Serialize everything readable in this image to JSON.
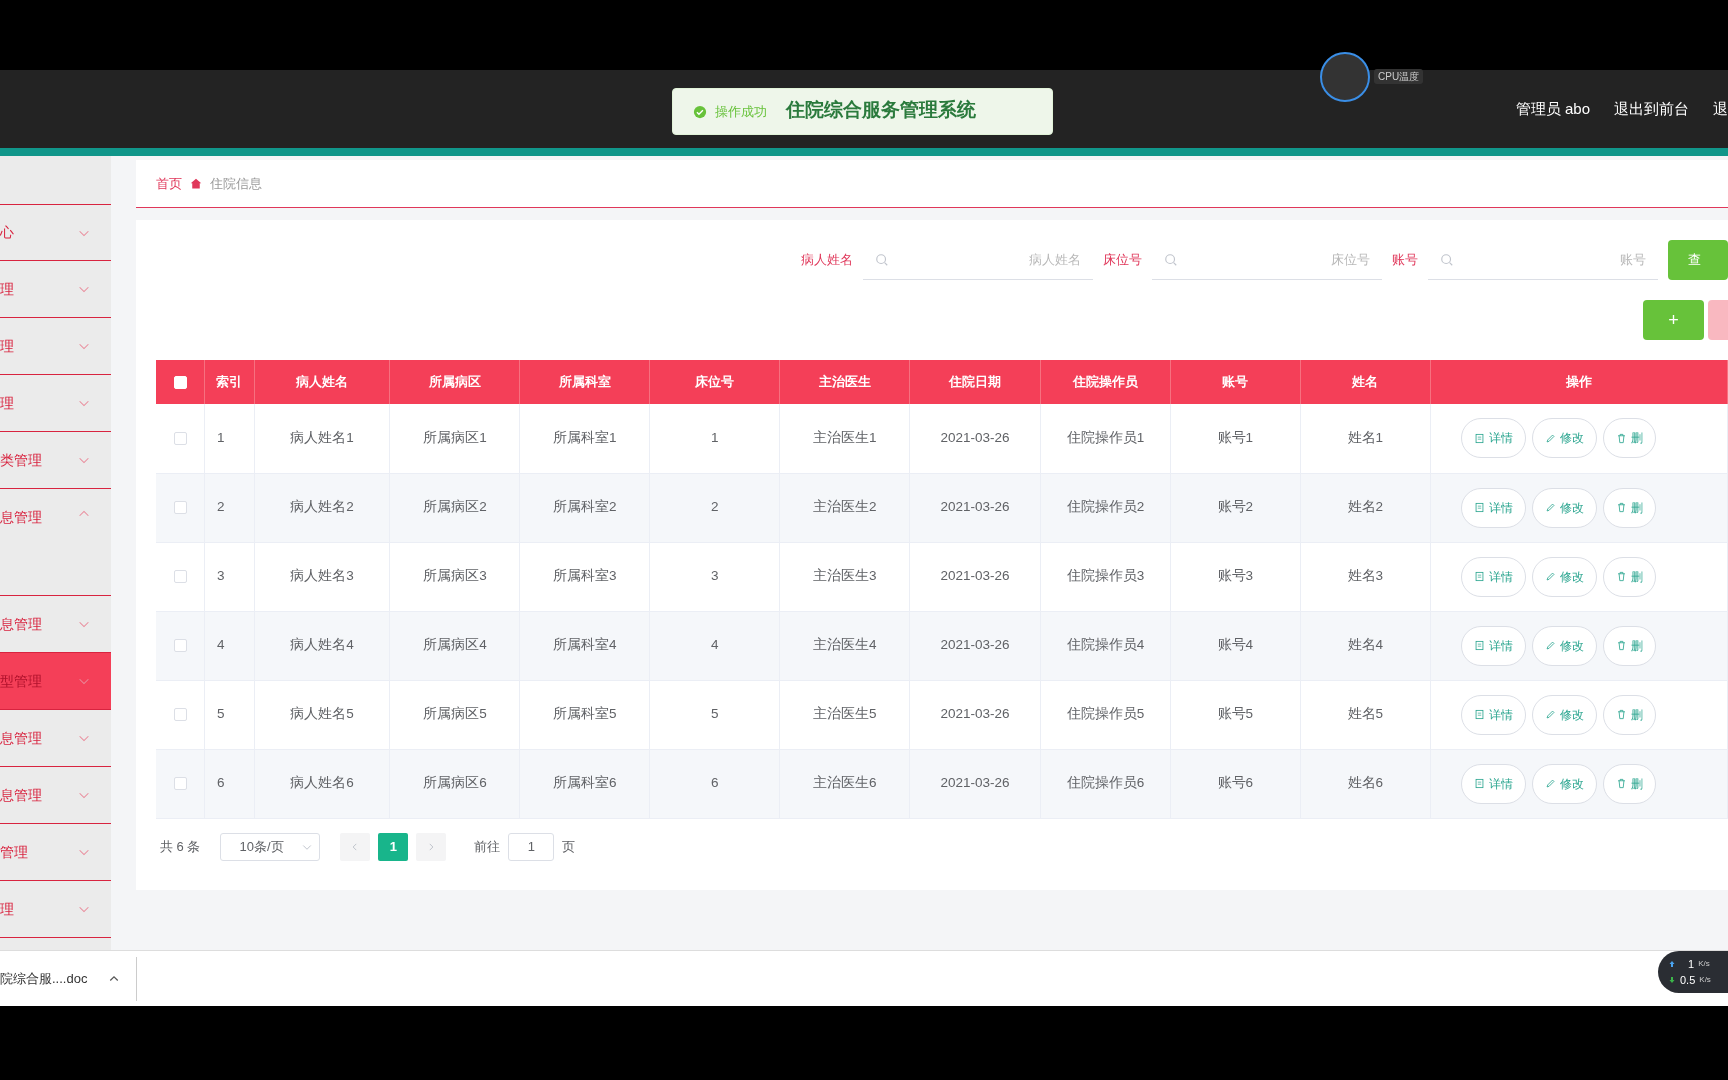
{
  "header": {
    "title": "住院综合服务管理系统",
    "user": "管理员 abo",
    "links": [
      "退出到前台",
      "退"
    ]
  },
  "toast": {
    "message": "操作成功"
  },
  "cpu_widget": {
    "label": "CPU温度"
  },
  "sidebar": {
    "items": [
      {
        "label": "心",
        "expanded": false,
        "selected": false
      },
      {
        "label": "理",
        "expanded": false,
        "selected": false
      },
      {
        "label": "理",
        "expanded": false,
        "selected": false
      },
      {
        "label": "理",
        "expanded": false,
        "selected": false
      },
      {
        "label": "类管理",
        "expanded": false,
        "selected": false
      },
      {
        "label": "息管理",
        "expanded": true,
        "selected": false
      },
      {
        "label": "息管理",
        "expanded": false,
        "selected": false
      },
      {
        "label": "型管理",
        "expanded": false,
        "selected": true
      },
      {
        "label": "息管理",
        "expanded": false,
        "selected": false
      },
      {
        "label": "息管理",
        "expanded": false,
        "selected": false
      },
      {
        "label": "管理",
        "expanded": false,
        "selected": false
      },
      {
        "label": "理",
        "expanded": false,
        "selected": false
      }
    ]
  },
  "breadcrumb": [
    "首页",
    "住院信息"
  ],
  "search": {
    "fields": [
      {
        "label": "病人姓名",
        "placeholder": "病人姓名"
      },
      {
        "label": "床位号",
        "placeholder": "床位号"
      },
      {
        "label": "账号",
        "placeholder": "账号"
      }
    ],
    "button": "查"
  },
  "toolbar": {
    "add_button": "+"
  },
  "table": {
    "all_selected": false,
    "columns": [
      "索引",
      "病人姓名",
      "所属病区",
      "所属科室",
      "床位号",
      "主治医生",
      "住院日期",
      "住院操作员",
      "账号",
      "姓名",
      "操作"
    ],
    "rows": [
      {
        "selected": false,
        "cells": [
          "1",
          "病人姓名1",
          "所属病区1",
          "所属科室1",
          "1",
          "主治医生1",
          "2021-03-26",
          "住院操作员1",
          "账号1",
          "姓名1"
        ],
        "actions": [
          "详情",
          "修改",
          "删"
        ]
      },
      {
        "selected": false,
        "cells": [
          "2",
          "病人姓名2",
          "所属病区2",
          "所属科室2",
          "2",
          "主治医生2",
          "2021-03-26",
          "住院操作员2",
          "账号2",
          "姓名2"
        ],
        "actions": [
          "详情",
          "修改",
          "删"
        ]
      },
      {
        "selected": false,
        "cells": [
          "3",
          "病人姓名3",
          "所属病区3",
          "所属科室3",
          "3",
          "主治医生3",
          "2021-03-26",
          "住院操作员3",
          "账号3",
          "姓名3"
        ],
        "actions": [
          "详情",
          "修改",
          "删"
        ]
      },
      {
        "selected": false,
        "cells": [
          "4",
          "病人姓名4",
          "所属病区4",
          "所属科室4",
          "4",
          "主治医生4",
          "2021-03-26",
          "住院操作员4",
          "账号4",
          "姓名4"
        ],
        "actions": [
          "详情",
          "修改",
          "删"
        ]
      },
      {
        "selected": false,
        "cells": [
          "5",
          "病人姓名5",
          "所属病区5",
          "所属科室5",
          "5",
          "主治医生5",
          "2021-03-26",
          "住院操作员5",
          "账号5",
          "姓名5"
        ],
        "actions": [
          "详情",
          "修改",
          "删"
        ]
      },
      {
        "selected": false,
        "cells": [
          "6",
          "病人姓名6",
          "所属病区6",
          "所属科室6",
          "6",
          "主治医生6",
          "2021-03-26",
          "住院操作员6",
          "账号6",
          "姓名6"
        ],
        "actions": [
          "详情",
          "修改",
          "删"
        ]
      }
    ]
  },
  "pagination": {
    "total": "共 6 条",
    "page_size": "10条/页",
    "pages": [
      {
        "label": "1",
        "selected": true
      }
    ],
    "goto_label": "前往",
    "goto_value": "1",
    "goto_suffix": "页"
  },
  "download_bar": {
    "file": "院综合服....doc"
  },
  "net_speed": {
    "up": "1",
    "up_unit": "K/s",
    "down": "0.5",
    "down_unit": "K/s"
  }
}
